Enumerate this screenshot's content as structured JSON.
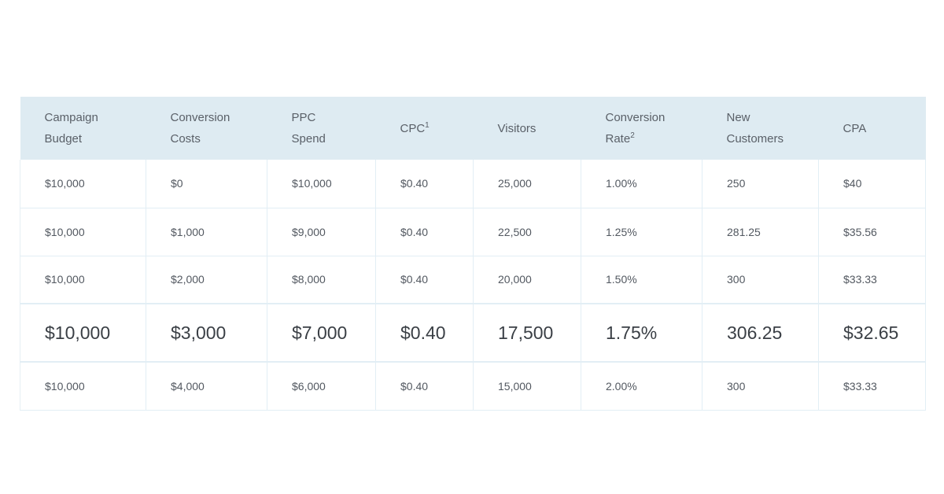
{
  "headers": [
    {
      "line1": "Campaign",
      "line2": "Budget",
      "sup": ""
    },
    {
      "line1": "Conversion",
      "line2": "Costs",
      "sup": ""
    },
    {
      "line1": "PPC",
      "line2": "Spend",
      "sup": ""
    },
    {
      "line1": "CPC",
      "line2": "",
      "sup": "1"
    },
    {
      "line1": "Visitors",
      "line2": "",
      "sup": ""
    },
    {
      "line1": "Conversion",
      "line2": "Rate",
      "sup": "2"
    },
    {
      "line1": "New",
      "line2": "Customers",
      "sup": ""
    },
    {
      "line1": "CPA",
      "line2": "",
      "sup": ""
    }
  ],
  "rows": [
    [
      "$10,000",
      "$0",
      "$10,000",
      "$0.40",
      "25,000",
      "1.00%",
      "250",
      "$40"
    ],
    [
      "$10,000",
      "$1,000",
      "$9,000",
      "$0.40",
      "22,500",
      "1.25%",
      "281.25",
      "$35.56"
    ],
    [
      "$10,000",
      "$2,000",
      "$8,000",
      "$0.40",
      "20,000",
      "1.50%",
      "300",
      "$33.33"
    ],
    [
      "$10,000",
      "$3,000",
      "$7,000",
      "$0.40",
      "17,500",
      "1.75%",
      "306.25",
      "$32.65"
    ],
    [
      "$10,000",
      "$4,000",
      "$6,000",
      "$0.40",
      "15,000",
      "2.00%",
      "300",
      "$33.33"
    ]
  ],
  "highlight_row": 3,
  "colors": {
    "header_bg": "#deebf2",
    "border": "#e2eef5",
    "text": "#525860"
  }
}
